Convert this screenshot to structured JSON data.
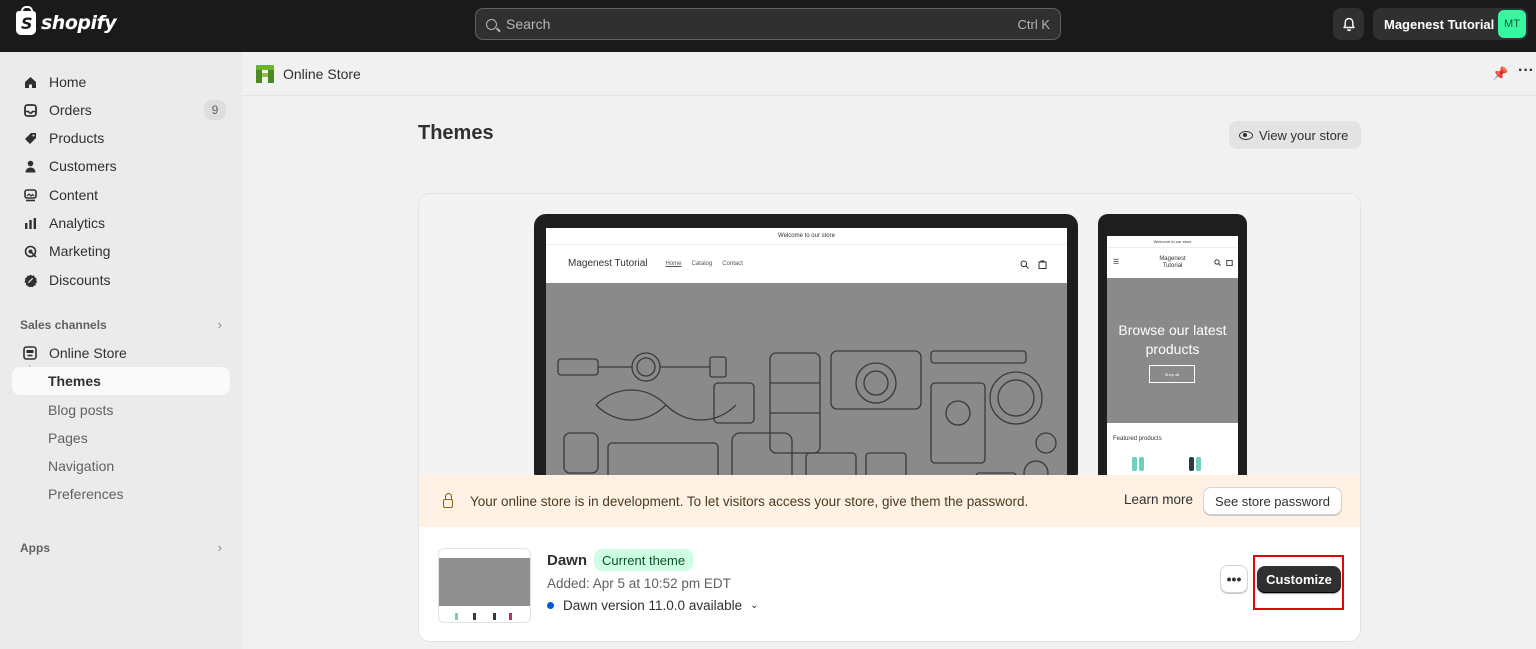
{
  "topbar": {
    "brand": "shopify",
    "search_placeholder": "Search",
    "search_shortcut": "Ctrl K",
    "account_name": "Magenest Tutorial",
    "account_initials": "MT"
  },
  "sidebar": {
    "items": [
      {
        "label": "Home",
        "icon": "home-icon"
      },
      {
        "label": "Orders",
        "icon": "orders-icon",
        "badge": "9"
      },
      {
        "label": "Products",
        "icon": "tag-icon"
      },
      {
        "label": "Customers",
        "icon": "person-icon"
      },
      {
        "label": "Content",
        "icon": "content-icon"
      },
      {
        "label": "Analytics",
        "icon": "analytics-icon"
      },
      {
        "label": "Marketing",
        "icon": "marketing-icon"
      },
      {
        "label": "Discounts",
        "icon": "discount-icon"
      }
    ],
    "sales_channels_title": "Sales channels",
    "online_store": "Online Store",
    "sub_items": [
      "Themes",
      "Blog posts",
      "Pages",
      "Navigation",
      "Preferences"
    ],
    "apps_title": "Apps"
  },
  "header": {
    "breadcrumb": "Online Store",
    "title": "Themes",
    "view_store": "View your store"
  },
  "preview": {
    "announcement": "Welcome to our store",
    "store_name": "Magenest Tutorial",
    "nav": [
      "Home",
      "Catalog",
      "Contact"
    ],
    "mobile_store_name": "Magenest Tutorial",
    "mobile_hero": "Browse our latest products",
    "mobile_button": "Shop all",
    "featured": "Featured products"
  },
  "alert": {
    "text": "Your online store is in development. To let visitors access your store, give them the password.",
    "learn_more": "Learn more",
    "password_button": "See store password"
  },
  "theme": {
    "name": "Dawn",
    "status": "Current theme",
    "added": "Added: Apr 5 at 10:52 pm EDT",
    "version": "Dawn version 11.0.0 available",
    "more": "•••",
    "customize": "Customize"
  },
  "colors": {
    "topbar": "#1a1a1a",
    "accent_highlight": "#e0060e",
    "status_badge": "#cdfee1",
    "version_dot": "#005bd3",
    "avatar": "#36f7a0"
  }
}
